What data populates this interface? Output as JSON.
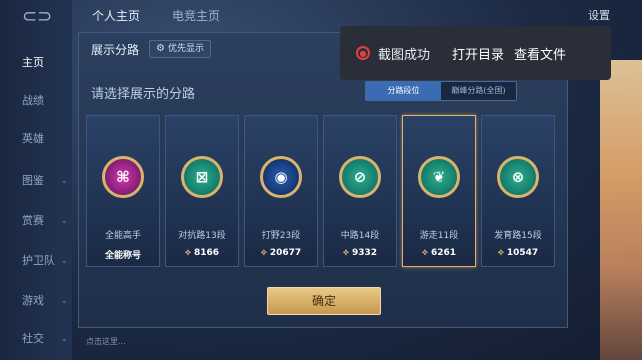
{
  "sidebar": {
    "items": [
      {
        "label": "主页",
        "chev": ""
      },
      {
        "label": "战绩",
        "chev": ""
      },
      {
        "label": "英雄",
        "chev": ""
      },
      {
        "label": "图鉴",
        "chev": "⌄"
      },
      {
        "label": "赏赛",
        "chev": "⌄"
      },
      {
        "label": "护卫队",
        "chev": "⌄"
      },
      {
        "label": "游戏",
        "chev": "⌄"
      },
      {
        "label": "社交",
        "chev": "⌄"
      }
    ]
  },
  "top": {
    "tab1": "个人主页",
    "tab2": "电竞主页",
    "settings": "设置"
  },
  "dialog": {
    "title": "展示分路",
    "priority_label": "优先显示",
    "prompt": "请选择展示的分路",
    "toggle": {
      "left": "分路段位",
      "right": "巅峰分路(全国)"
    },
    "cards": [
      {
        "label": "全能高手",
        "score": "全能称号",
        "glyph": "⌘",
        "style": "gold"
      },
      {
        "label": "对抗路13段",
        "score": "8166",
        "glyph": "⊠",
        "style": "teal"
      },
      {
        "label": "打野23段",
        "score": "20677",
        "glyph": "◉",
        "style": "jungle"
      },
      {
        "label": "中路14段",
        "score": "9332",
        "glyph": "⊘",
        "style": "teal"
      },
      {
        "label": "游走11段",
        "score": "6261",
        "glyph": "❦",
        "style": "teal"
      },
      {
        "label": "发育路15段",
        "score": "10547",
        "glyph": "⊗",
        "style": "teal"
      }
    ],
    "confirm": "确定"
  },
  "toast": {
    "message": "截图成功",
    "open_dir": "打开目录",
    "view_file": "查看文件"
  },
  "chat": {
    "placeholder": "点击这里..."
  },
  "colors": {
    "accent_gold": "#e3b06d",
    "toast_error": "#e04242",
    "toggle_active": "#3b6bb4"
  }
}
